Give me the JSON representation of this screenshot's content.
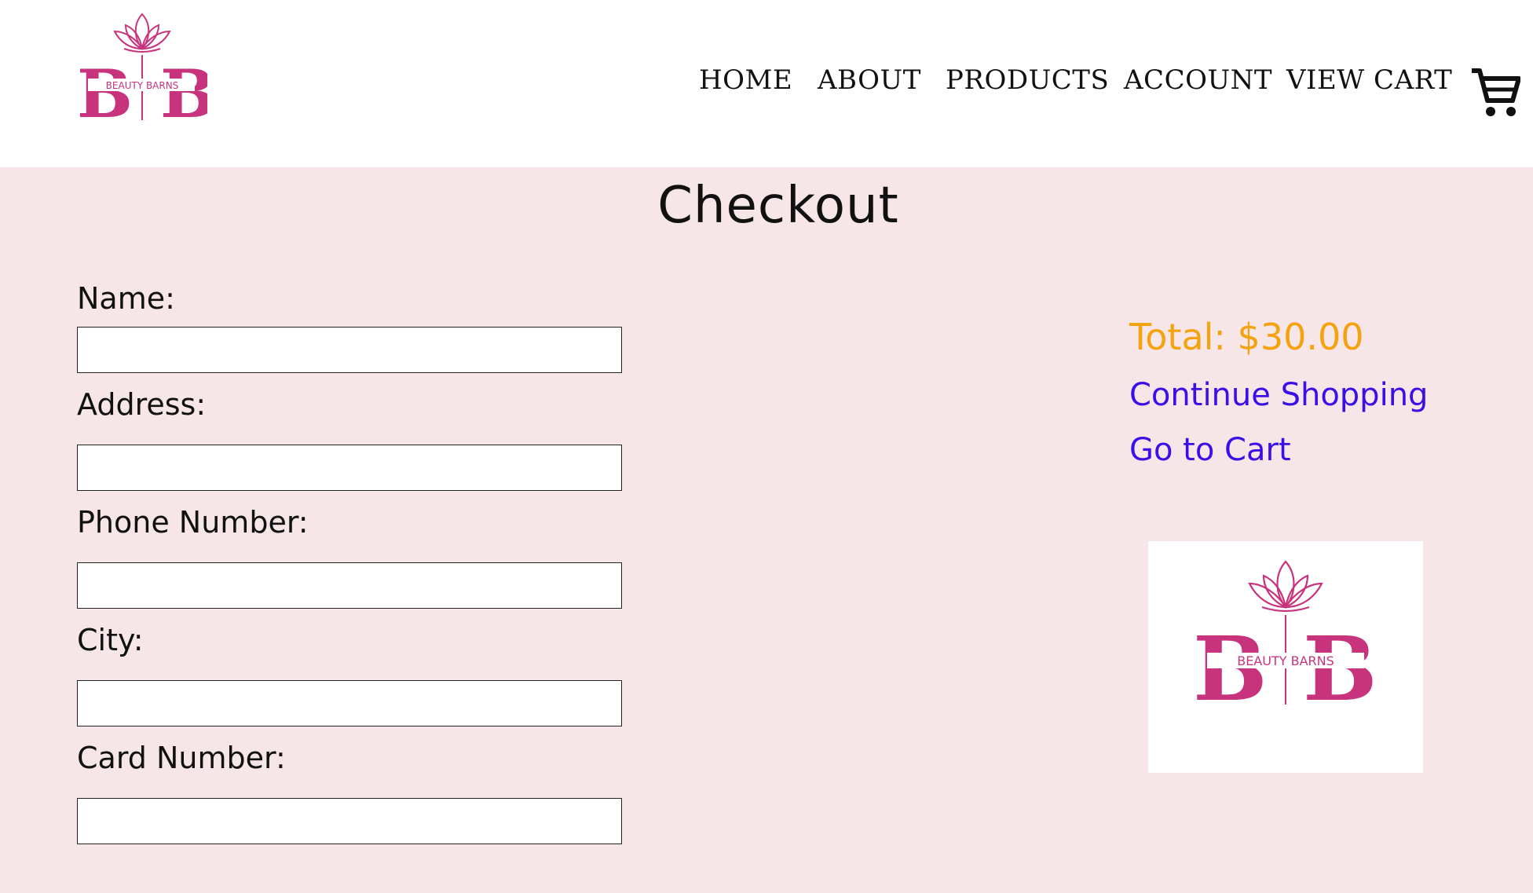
{
  "brand": {
    "name": "BEAUTY BARNS",
    "letters": "B B",
    "color": "#c7347d"
  },
  "nav": {
    "items": [
      "HOME",
      "ABOUT",
      "PRODUCTS",
      "ACCOUNT",
      "VIEW CART"
    ],
    "cart_icon": "shopping-cart-icon"
  },
  "page": {
    "title": "Checkout"
  },
  "form": {
    "fields": [
      {
        "label": "Name:",
        "value": "",
        "placeholder": ""
      },
      {
        "label": "Address:",
        "value": "",
        "placeholder": ""
      },
      {
        "label": "Phone Number:",
        "value": "",
        "placeholder": ""
      },
      {
        "label": "City:",
        "value": "",
        "placeholder": ""
      },
      {
        "label": "Card Number:",
        "value": "",
        "placeholder": ""
      }
    ]
  },
  "summary": {
    "total": "Total: $30.00",
    "continue_shopping": "Continue Shopping",
    "go_to_cart": "Go to Cart"
  },
  "colors": {
    "page_bg": "#f6e6e7",
    "total": "#f5a20f",
    "link": "#3a0fe8"
  }
}
